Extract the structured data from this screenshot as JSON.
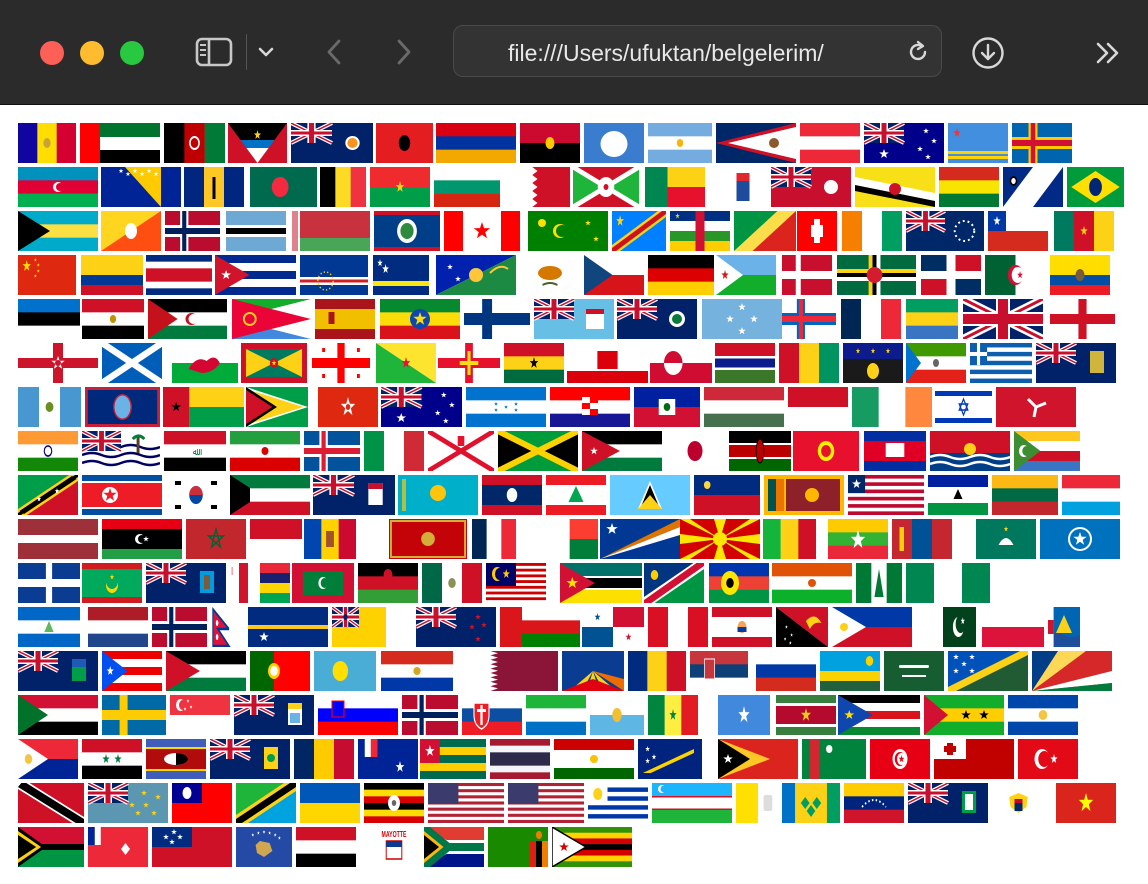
{
  "browser": {
    "address_text": "file:///Users/ufuktan/belgelerim/",
    "traffic_lights": {
      "close": "#fe5f57",
      "minimize": "#febc2e",
      "zoom": "#28c840"
    },
    "icons": [
      "sidebar-icon",
      "chevron-down-icon",
      "back-icon",
      "forward-icon",
      "reload-icon",
      "download-icon",
      "more-icon"
    ]
  },
  "flags": [
    [
      "AD",
      "AE",
      "AF",
      "AG",
      "AI",
      "AL",
      "AM",
      "AO",
      "AQ",
      "AR",
      "AS",
      "AT",
      "AU",
      "AW",
      "AX"
    ],
    [
      "AZ",
      "BA",
      "BB",
      "BD",
      "BE",
      "BF",
      "BG",
      "BH",
      "BI",
      "BJ",
      "BL",
      "BM",
      "BN",
      "BO",
      "BQ",
      "BR"
    ],
    [
      "BS",
      "BT",
      "BV",
      "BW",
      "BY",
      "BZ",
      "CA",
      "CC",
      "CD",
      "CF",
      "CG",
      "CH",
      "CI",
      "CK",
      "CL",
      "CM"
    ],
    [
      "CN",
      "CO",
      "CR",
      "CU",
      "CV",
      "CW",
      "CX",
      "CY",
      "CZ",
      "DE",
      "DJ",
      "DK",
      "DM",
      "DO",
      "DZ",
      "EC"
    ],
    [
      "EE",
      "EG",
      "EH",
      "ER",
      "ES",
      "ET",
      "FI",
      "FJ",
      "FK",
      "FM",
      "FO",
      "FR",
      "GA",
      "GB",
      "GB-ENG"
    ],
    [
      "GB-NIR",
      "GB-SCT",
      "GB-WLS",
      "GD",
      "GE",
      "GF",
      "GG",
      "GH",
      "GI",
      "GL",
      "GM",
      "GN",
      "GP",
      "GQ",
      "GR",
      "GS"
    ],
    [
      "GT",
      "GU",
      "GW",
      "GY",
      "HK",
      "HM",
      "HN",
      "HR",
      "HT",
      "HU",
      "ID",
      "IE",
      "IL",
      "IM"
    ],
    [
      "IN",
      "IO",
      "IQ",
      "IR",
      "IS",
      "IT",
      "JE",
      "JM",
      "JO",
      "JP",
      "KE",
      "KG",
      "KH",
      "KI",
      "KM"
    ],
    [
      "KN",
      "KP",
      "KR",
      "KW",
      "KY",
      "KZ",
      "LA",
      "LB",
      "LC",
      "LI",
      "LK",
      "LR",
      "LS",
      "LT",
      "LU"
    ],
    [
      "LV",
      "LY",
      "MA",
      "MC",
      "MD",
      "ME",
      "MF",
      "MG",
      "MH",
      "MK",
      "ML",
      "MM",
      "MN",
      "MO",
      "MP"
    ],
    [
      "MQ",
      "MR",
      "MS",
      "MT",
      "MU",
      "MV",
      "MW",
      "MX",
      "MY",
      "MZ",
      "NA",
      "NC",
      "NE",
      "NF",
      "NG"
    ],
    [
      "NI",
      "NL",
      "NO",
      "NP",
      "NR",
      "NU",
      "NZ",
      "OM",
      "PA",
      "PE",
      "PF",
      "PG",
      "PH",
      "PK",
      "PL",
      "PM"
    ],
    [
      "PN",
      "PR",
      "PS",
      "PT",
      "PW",
      "PY",
      "QA",
      "RE",
      "RO",
      "RS",
      "RU",
      "RW",
      "SA",
      "SB",
      "SC"
    ],
    [
      "SD",
      "SE",
      "SG",
      "SH",
      "SI",
      "SJ",
      "SK",
      "SL",
      "SM",
      "SN",
      "SO",
      "SR",
      "SS",
      "ST",
      "SV"
    ],
    [
      "SX",
      "SY",
      "SZ",
      "TC",
      "TD",
      "TF",
      "TG",
      "TH",
      "TJ",
      "TK",
      "TL",
      "TM",
      "TN",
      "TO",
      "TR"
    ],
    [
      "TT",
      "TV",
      "TW",
      "TZ",
      "UA",
      "UG",
      "UM",
      "US",
      "UY",
      "UZ",
      "VA",
      "VC",
      "VE",
      "VG",
      "VI",
      "VN"
    ],
    [
      "VU",
      "WF",
      "WS",
      "XK",
      "YE",
      "YT",
      "ZA",
      "ZM",
      "ZW"
    ]
  ],
  "mayotte_label": "MAYOTTE"
}
